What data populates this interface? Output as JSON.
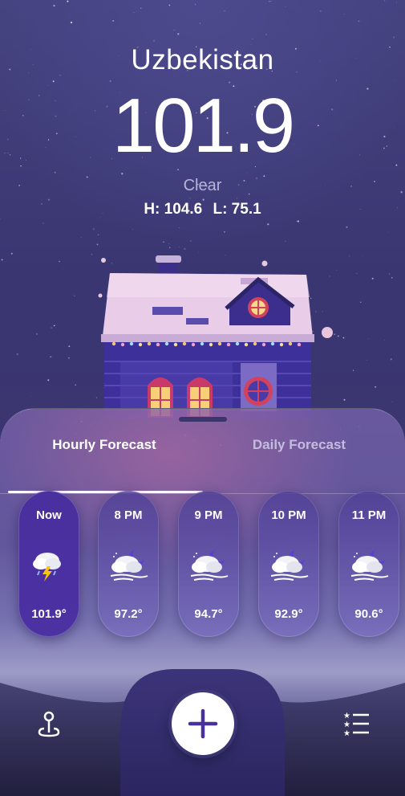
{
  "location": "Uzbekistan",
  "temperature": "101.9",
  "condition": "Clear",
  "high": "H: 104.6",
  "low": "L: 75.1",
  "tabs": {
    "hourly": "Hourly Forecast",
    "daily": "Daily Forecast",
    "active": "hourly"
  },
  "hourly": [
    {
      "time": "Now",
      "temp": "101.9°",
      "icon": "thunderstorm-icon"
    },
    {
      "time": "8 PM",
      "temp": "97.2°",
      "icon": "night-cloud-wind-icon"
    },
    {
      "time": "9 PM",
      "temp": "94.7°",
      "icon": "night-cloud-wind-icon"
    },
    {
      "time": "10 PM",
      "temp": "92.9°",
      "icon": "night-cloud-wind-icon"
    },
    {
      "time": "11 PM",
      "temp": "90.6°",
      "icon": "night-cloud-wind-icon"
    }
  ],
  "navbar": {
    "left_icon": "location-pin-icon",
    "center_icon": "plus-icon",
    "right_icon": "list-icon"
  },
  "colors": {
    "accent": "#48319D",
    "sky_top": "#45427F",
    "sheet": "#6E60AA"
  }
}
